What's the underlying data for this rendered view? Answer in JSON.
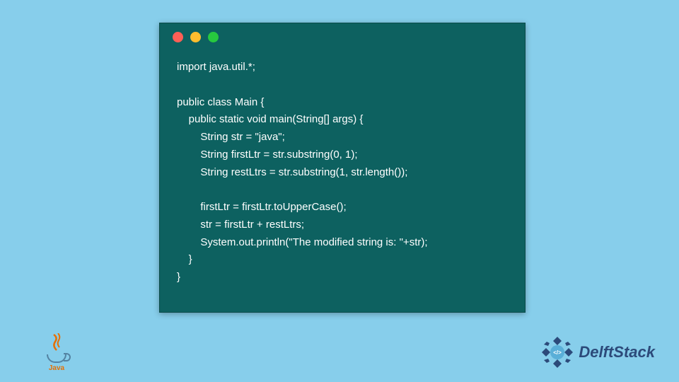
{
  "code_lines": [
    "import java.util.*;",
    "",
    "public class Main {",
    "    public static void main(String[] args) {",
    "        String str = \"java\";",
    "        String firstLtr = str.substring(0, 1);",
    "        String restLtrs = str.substring(1, str.length());",
    "",
    "        firstLtr = firstLtr.toUpperCase();",
    "        str = firstLtr + restLtrs;",
    "        System.out.println(\"The modified string is: \"+str);",
    "    }",
    "}"
  ],
  "java_logo_text": "Java",
  "delftstack_text": "DelftStack",
  "colors": {
    "background": "#87ceeb",
    "code_bg": "#0d6160",
    "code_text": "#ffffff",
    "dot_red": "#ff5f56",
    "dot_yellow": "#ffbd2e",
    "dot_green": "#27c93f",
    "java_orange": "#e76f00",
    "java_blue": "#5382a1",
    "delft_blue": "#2c4a7a"
  }
}
